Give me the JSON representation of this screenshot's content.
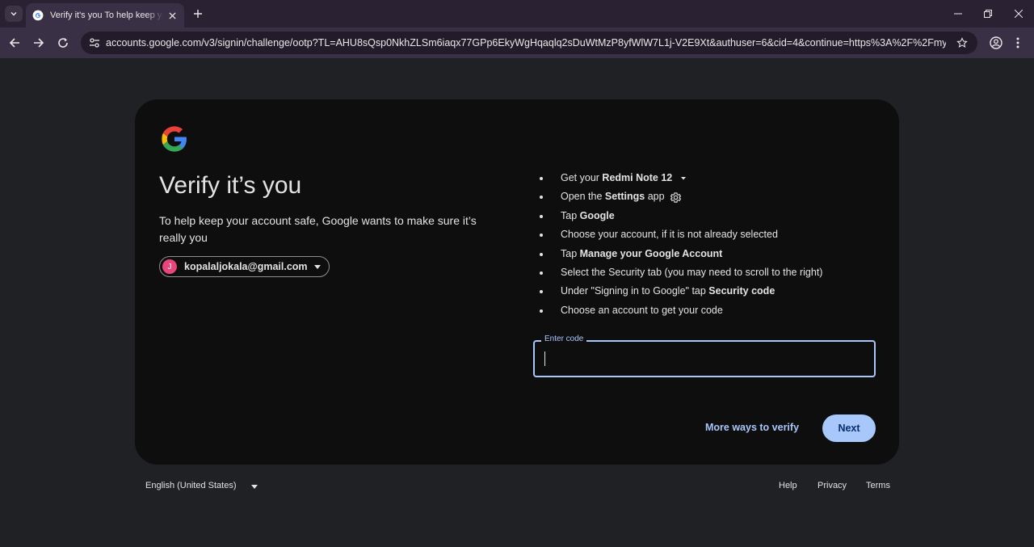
{
  "browser": {
    "tab": {
      "title": "Verify it's you To help keep your account safe"
    },
    "url": "accounts.google.com/v3/signin/challenge/ootp?TL=AHU8sQsp0NkhZLSm6iaqx77GPp6EkyWgHqaqlq2sDuWtMzP8yfWlW7L1j-V2E9Xt&authuser=6&cid=4&continue=https%3A%2F%2Fmyaccount.goo..."
  },
  "card": {
    "headline": "Verify it’s you",
    "subtext": "To help keep your account safe, Google wants to make sure it’s really you",
    "account": {
      "initial": "J",
      "email": "kopalaljokala@gmail.com"
    },
    "steps": [
      {
        "pre": "Get your ",
        "bold": "Redmi Note 12",
        "post": ""
      },
      {
        "pre": "Open the ",
        "bold": "Settings",
        "post": " app"
      },
      {
        "pre": "Tap ",
        "bold": "Google",
        "post": ""
      },
      {
        "pre": "Choose your account, if it is not already selected",
        "bold": "",
        "post": ""
      },
      {
        "pre": "Tap ",
        "bold": "Manage your Google Account",
        "post": ""
      },
      {
        "pre": "Select the Security tab (you may need to scroll to the right)",
        "bold": "",
        "post": ""
      },
      {
        "pre": "Under \"Signing in to Google\" tap ",
        "bold": "Security code",
        "post": ""
      },
      {
        "pre": "Choose an account to get your code",
        "bold": "",
        "post": ""
      }
    ],
    "code_field": {
      "label": "Enter code",
      "value": ""
    },
    "more_ways": "More ways to verify",
    "next": "Next"
  },
  "footer": {
    "language": "English (United States)",
    "help": "Help",
    "privacy": "Privacy",
    "terms": "Terms"
  },
  "colors": {
    "accent": "#a8c7fa",
    "card_bg": "#0e0e0e",
    "page_bg": "#202124",
    "avatar": "#e8457a"
  }
}
